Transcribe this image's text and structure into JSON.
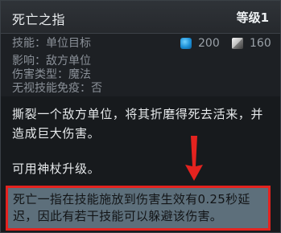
{
  "header": {
    "ability_name": "死亡之指",
    "level": "等级1"
  },
  "stats": {
    "ability_line": "技能：单位目标",
    "affects_line": "影响：敌方单位",
    "damage_type_line": "伤害类型：魔法",
    "spell_immunity_line": "无视技能免疫：否",
    "mana_cost": "200",
    "cooldown": "160"
  },
  "description": "撕裂一个敌方单位，将其折磨得死去活来，并造成巨大伤害。",
  "upgrade_note": "可用神杖升级。",
  "highlight_note": "死亡一指在技能施放到伤害生效有0.25秒延迟，因此有若干技能可以躲避该伤害。",
  "icons": {
    "mana": "mana-icon",
    "cooldown": "cooldown-icon",
    "arrow": "arrow-down-icon"
  },
  "colors": {
    "annotation_red": "#e4231f",
    "note_background": "#5d6f7b",
    "mana_blue": "#1c8fd6"
  }
}
